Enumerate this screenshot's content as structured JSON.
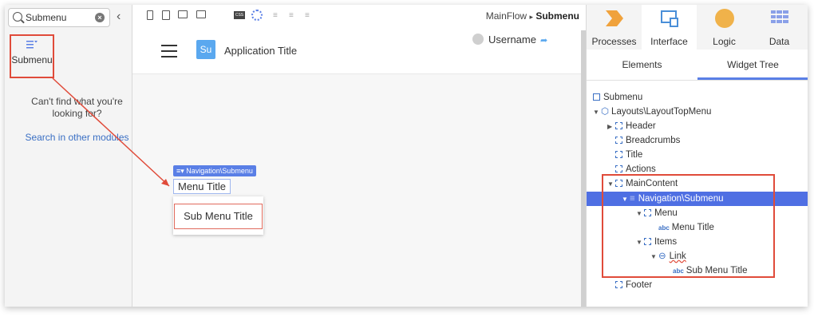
{
  "search": {
    "value": "Submenu"
  },
  "left": {
    "result_label": "Submenu",
    "not_found": "Can't find what you're looking for?",
    "search_other": "Search in other modules"
  },
  "toolbar": {
    "css_label": "CSS",
    "breadcrumb_parent": "MainFlow",
    "breadcrumb_sep": "▸",
    "breadcrumb_current": "Submenu"
  },
  "app": {
    "logo": "Su",
    "title": "Application Title",
    "username": "Username"
  },
  "canvas_widget": {
    "tag": "Navigation\\Submenu",
    "menu_title": "Menu Title",
    "sub_menu_title": "Sub Menu Title"
  },
  "right": {
    "tabs": [
      {
        "label": "Processes",
        "icon": "processes-icon"
      },
      {
        "label": "Interface",
        "icon": "interface-icon"
      },
      {
        "label": "Logic",
        "icon": "logic-icon"
      },
      {
        "label": "Data",
        "icon": "data-icon"
      }
    ],
    "subtabs": [
      "Elements",
      "Widget Tree"
    ]
  },
  "tree": [
    {
      "label": "Submenu",
      "icon": "screen-icon",
      "indent": 0
    },
    {
      "label": "Layouts\\LayoutTopMenu",
      "icon": "block-icon",
      "indent": 1
    },
    {
      "label": "Header",
      "icon": "placeholder-icon",
      "indent": 2
    },
    {
      "label": "Breadcrumbs",
      "icon": "placeholder-icon",
      "indent": 2
    },
    {
      "label": "Title",
      "icon": "placeholder-icon",
      "indent": 2
    },
    {
      "label": "Actions",
      "icon": "placeholder-icon",
      "indent": 2
    },
    {
      "label": "MainContent",
      "icon": "placeholder-icon",
      "indent": 2
    },
    {
      "label": "Navigation\\Submenu",
      "icon": "submenu-icon",
      "indent": 3
    },
    {
      "label": "Menu",
      "icon": "placeholder-icon",
      "indent": 4
    },
    {
      "label": "Menu Title",
      "icon": "text-icon",
      "indent": 5
    },
    {
      "label": "Items",
      "icon": "placeholder-icon",
      "indent": 4
    },
    {
      "label": "Link",
      "icon": "link-icon",
      "indent": 5
    },
    {
      "label": "Sub Menu Title",
      "icon": "text-icon",
      "indent": 6
    },
    {
      "label": "Footer",
      "icon": "placeholder-icon",
      "indent": 2
    }
  ],
  "colors": {
    "accent": "#4f6fe3",
    "highlight_red": "#e04b3a",
    "logo_blue": "#5aa8ef"
  }
}
